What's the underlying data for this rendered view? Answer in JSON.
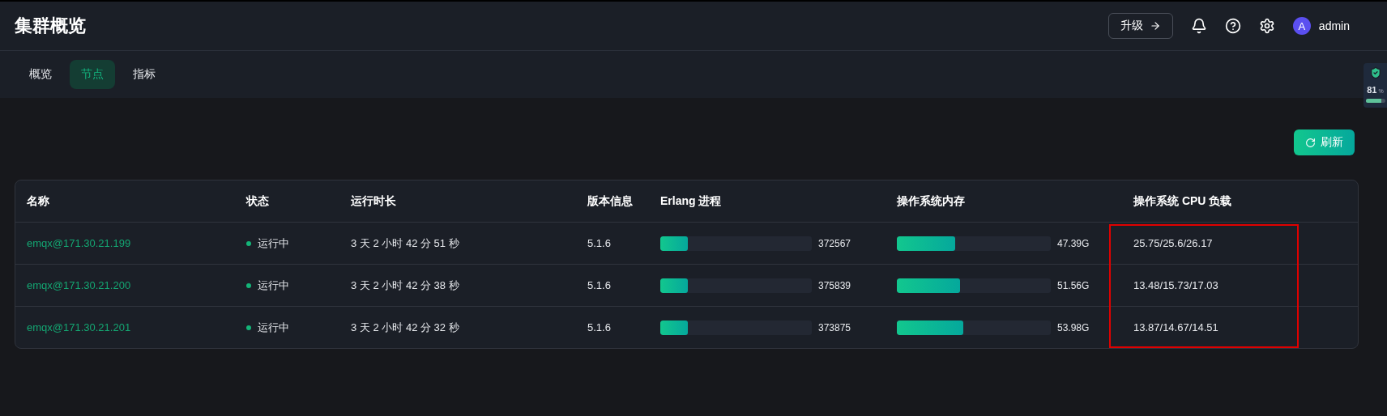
{
  "header": {
    "title": "集群概览",
    "upgrade_button": "升级",
    "user": {
      "avatar": "A",
      "name": "admin"
    }
  },
  "tabs": [
    {
      "label": "概览",
      "selected": false
    },
    {
      "label": "节点",
      "selected": true
    },
    {
      "label": "指标",
      "selected": false
    }
  ],
  "side_widget": {
    "value": "81",
    "unit": "%",
    "level": 0.81
  },
  "refresh_button": "刷新",
  "table": {
    "columns": [
      "名称",
      "状态",
      "运行时长",
      "版本信息",
      "Erlang 进程",
      "操作系统内存",
      "操作系统 CPU 负载"
    ],
    "rows": [
      {
        "name": "emqx@171.30.21.199",
        "status": "运行中",
        "running": true,
        "uptime": "3 天 2 小时 42 分 51 秒",
        "version": "5.1.6",
        "erlang": {
          "level": 0.18,
          "value": "372567"
        },
        "memory": {
          "level": 0.377,
          "value": "47.39G"
        },
        "cpu": "25.75/25.6/26.17"
      },
      {
        "name": "emqx@171.30.21.200",
        "status": "运行中",
        "running": true,
        "uptime": "3 天 2 小时 42 分 38 秒",
        "version": "5.1.6",
        "erlang": {
          "level": 0.18,
          "value": "375839"
        },
        "memory": {
          "level": 0.41,
          "value": "51.56G"
        },
        "cpu": "13.48/15.73/17.03"
      },
      {
        "name": "emqx@171.30.21.201",
        "status": "运行中",
        "running": true,
        "uptime": "3 天 2 小时 42 分 32 秒",
        "version": "5.1.6",
        "erlang": {
          "level": 0.18,
          "value": "373875"
        },
        "memory": {
          "level": 0.43,
          "value": "53.98G"
        },
        "cpu": "13.87/14.67/14.51"
      }
    ]
  },
  "highlight": {
    "shown": true
  }
}
